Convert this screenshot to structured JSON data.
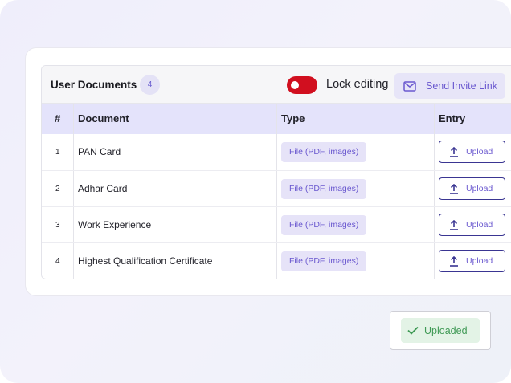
{
  "panel": {
    "title": "User Documents",
    "count": "4",
    "lock_label": "Lock editing",
    "lock_enabled": true,
    "invite_label": "Send Invite Link"
  },
  "table": {
    "headers": [
      "#",
      "Document",
      "Type",
      "Entry"
    ],
    "rows": [
      {
        "num": "1",
        "document": "PAN Card",
        "type": "File (PDF, images)",
        "action": "Upload"
      },
      {
        "num": "2",
        "document": "Adhar Card",
        "type": "File (PDF, images)",
        "action": "Upload"
      },
      {
        "num": "3",
        "document": "Work Experience",
        "type": "File (PDF, images)",
        "action": "Upload"
      },
      {
        "num": "4",
        "document": "Highest Qualification Certificate",
        "type": "File (PDF, images)",
        "action": "Upload"
      }
    ]
  },
  "status": {
    "uploaded_label": "Uploaded"
  },
  "colors": {
    "accent": "#6a58cf",
    "toggle_on": "#d10f1f",
    "success": "#3f9a55"
  },
  "icons": {
    "invite": "mail-icon",
    "upload": "upload-icon",
    "uploaded": "check-icon"
  }
}
